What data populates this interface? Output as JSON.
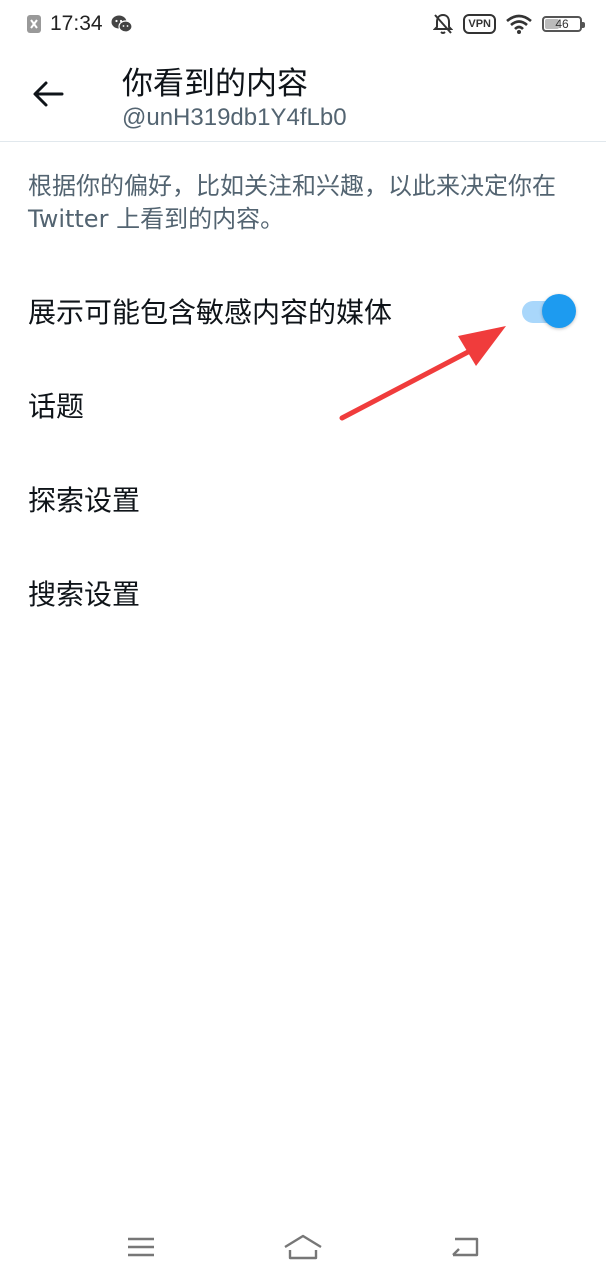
{
  "status_bar": {
    "time": "17:34",
    "vpn_label": "VPN",
    "battery_level": "46",
    "icons": [
      "notification-x-icon",
      "wechat-icon",
      "bell-off-icon",
      "vpn-icon",
      "wifi-icon",
      "battery-icon"
    ]
  },
  "header": {
    "title": "你看到的内容",
    "subtitle": "@unH319db1Y4fLb0",
    "back_icon": "back-arrow-icon"
  },
  "description": "根据你的偏好，比如关注和兴趣，以此来决定你在 Twitter 上看到的内容。",
  "settings": [
    {
      "label": "展示可能包含敏感内容的媒体",
      "toggle": true,
      "checked": true
    },
    {
      "label": "话题"
    },
    {
      "label": "探索设置"
    },
    {
      "label": "搜索设置"
    }
  ],
  "colors": {
    "accent": "#1d9bf0",
    "toggle_track": "#a9d7fb",
    "annotation_arrow": "#f03c3c",
    "secondary_text": "#536471"
  },
  "nav_bar": {
    "icons": [
      "menu-icon",
      "home-icon",
      "back-icon"
    ]
  }
}
